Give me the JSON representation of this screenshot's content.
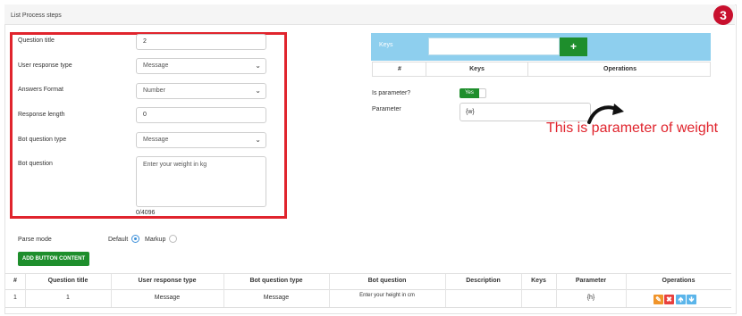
{
  "panel": {
    "title": "List Process steps",
    "step_badge": "3"
  },
  "form": {
    "question_title": {
      "label": "Question title",
      "value": "2"
    },
    "user_response_type": {
      "label": "User response type",
      "value": "Message"
    },
    "answers_format": {
      "label": "Answers Format",
      "value": "Number"
    },
    "response_length": {
      "label": "Response length",
      "value": "0"
    },
    "bot_question_type": {
      "label": "Bot question type",
      "value": "Message"
    },
    "bot_question": {
      "label": "Bot question",
      "value": "Enter your weight in kg",
      "counter": "0/4096"
    }
  },
  "keys": {
    "label": "Keys",
    "add_icon": "plus-icon",
    "add_symbol": "+",
    "table_headers": [
      "#",
      "Keys",
      "Operations"
    ]
  },
  "parameter": {
    "is_parameter_label": "Is parameter?",
    "toggle_value": "Yes",
    "parameter_label": "Parameter",
    "parameter_value": "{w}",
    "annotation": "This is parameter of weight"
  },
  "parse": {
    "label": "Parse mode",
    "options": [
      "Default",
      "Markup"
    ],
    "selected": "Default"
  },
  "add_button_content": "ADD BUTTON CONTENT",
  "steps_table": {
    "headers": [
      "#",
      "Question title",
      "User response type",
      "Bot question type",
      "Bot question",
      "Description",
      "Keys",
      "Parameter",
      "Operations"
    ],
    "rows": [
      [
        "1",
        "1",
        "Message",
        "Message",
        "Enter your height in cm",
        "",
        "",
        "{h}"
      ]
    ]
  },
  "colors": {
    "accent_green": "#1e8e2c",
    "keys_bar": "#8ecfee",
    "highlight_red": "#e0242d",
    "edit_orange": "#f0942a",
    "delete_red": "#e8403d",
    "move_blue": "#5bb5ea"
  },
  "operation_icons": [
    "pencil-icon",
    "cross-icon",
    "arrow-up-icon",
    "arrow-down-icon"
  ]
}
